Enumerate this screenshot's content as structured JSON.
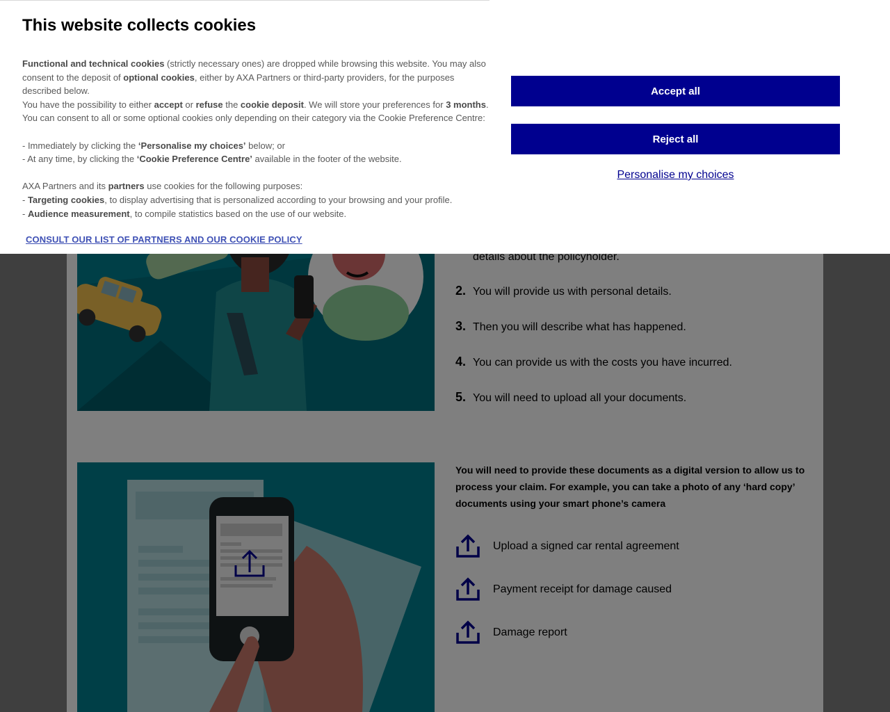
{
  "cookie_banner": {
    "title": "This website collects cookies",
    "p1": [
      {
        "t": "Functional and technical cookies",
        "b": true
      },
      {
        "t": " (strictly necessary ones) are dropped while browsing this website. You may also consent to the deposit of ",
        "b": false
      },
      {
        "t": "optional cookies",
        "b": true
      },
      {
        "t": ", either by AXA Partners or third-party providers, for the purposes described below.",
        "b": false
      }
    ],
    "p2": [
      {
        "t": "You have the possibility to either ",
        "b": false
      },
      {
        "t": "accept",
        "b": true
      },
      {
        "t": " or ",
        "b": false
      },
      {
        "t": "refuse",
        "b": true
      },
      {
        "t": " the ",
        "b": false
      },
      {
        "t": "cookie deposit",
        "b": true
      },
      {
        "t": ". We will store your preferences for ",
        "b": false
      },
      {
        "t": "3 months",
        "b": true
      },
      {
        "t": ".",
        "b": false
      }
    ],
    "p3": [
      {
        "t": "You can consent to all or some optional cookies only depending on their category via the Cookie Preference Centre:",
        "b": false
      }
    ],
    "p4": [
      {
        "t": "- Immediately by clicking the ",
        "b": false
      },
      {
        "t": "‘Personalise my choices’",
        "b": true
      },
      {
        "t": " below; or",
        "b": false
      }
    ],
    "p5": [
      {
        "t": "- At any time, by clicking the ",
        "b": false
      },
      {
        "t": "‘Cookie Preference Centre’",
        "b": true
      },
      {
        "t": " available in the footer of the website.",
        "b": false
      }
    ],
    "p6": [
      {
        "t": "AXA Partners and its ",
        "b": false
      },
      {
        "t": "partners",
        "b": true
      },
      {
        "t": " use cookies for the following purposes:",
        "b": false
      }
    ],
    "p7": [
      {
        "t": "- ",
        "b": false
      },
      {
        "t": "Targeting cookies",
        "b": true
      },
      {
        "t": ", to display advertising that is personalized according to your browsing and your profile.",
        "b": false
      }
    ],
    "p8": [
      {
        "t": "- ",
        "b": false
      },
      {
        "t": "Audience measurement",
        "b": true
      },
      {
        "t": ", to compile statistics based on the use of our website.",
        "b": false
      }
    ],
    "policy_link": "CONSULT OUR LIST OF PARTNERS AND OUR COOKIE POLICY",
    "accept_label": "Accept all",
    "reject_label": "Reject all",
    "personalise_label": "Personalise my choices"
  },
  "steps": [
    {
      "num": "",
      "text": "details about the policyholder."
    },
    {
      "num": "2.",
      "text": "You will provide us with personal details."
    },
    {
      "num": "3.",
      "text": "Then you will describe what has happened."
    },
    {
      "num": "4.",
      "text": "You can provide us with the costs you have incurred."
    },
    {
      "num": "5.",
      "text": "You will need to upload all your documents."
    }
  ],
  "documents": {
    "intro": "You will need to provide these documents as a digital version to allow us to process your claim. For example, you can take a photo of any ‘hard copy’ documents using your smart phone’s camera",
    "items": [
      {
        "label": "Upload a signed car rental agreement",
        "icon": "upload-icon"
      },
      {
        "label": "Payment receipt for damage caused",
        "icon": "upload-icon"
      },
      {
        "label": "Damage report",
        "icon": "upload-icon"
      }
    ]
  },
  "colors": {
    "brand_blue": "#00008f",
    "teal": "#006d7b",
    "overlay": "rgba(0,0,0,0.5)",
    "link": "#3f51b5"
  }
}
